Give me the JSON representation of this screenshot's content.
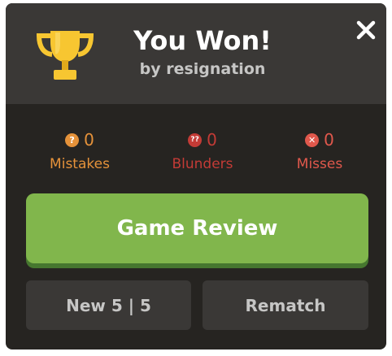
{
  "header": {
    "title": "You Won!",
    "subtitle": "by resignation",
    "trophy_icon": "trophy-icon",
    "close_icon": "close-icon"
  },
  "stats": [
    {
      "label": "Mistakes",
      "count": "0",
      "icon": "question-mark-icon",
      "color": "#e5923a"
    },
    {
      "label": "Blunders",
      "count": "0",
      "icon": "double-question-mark-icon",
      "color": "#c33b36"
    },
    {
      "label": "Misses",
      "count": "0",
      "icon": "x-circle-icon",
      "color": "#e0584c"
    }
  ],
  "actions": {
    "review_label": "Game Review",
    "new_game_label": "New 5 | 5",
    "rematch_label": "Rematch"
  },
  "colors": {
    "modal_bg": "#262421",
    "header_bg": "#3a3836",
    "accent_green": "#81b64c",
    "trophy_gold": "#f7c631"
  }
}
